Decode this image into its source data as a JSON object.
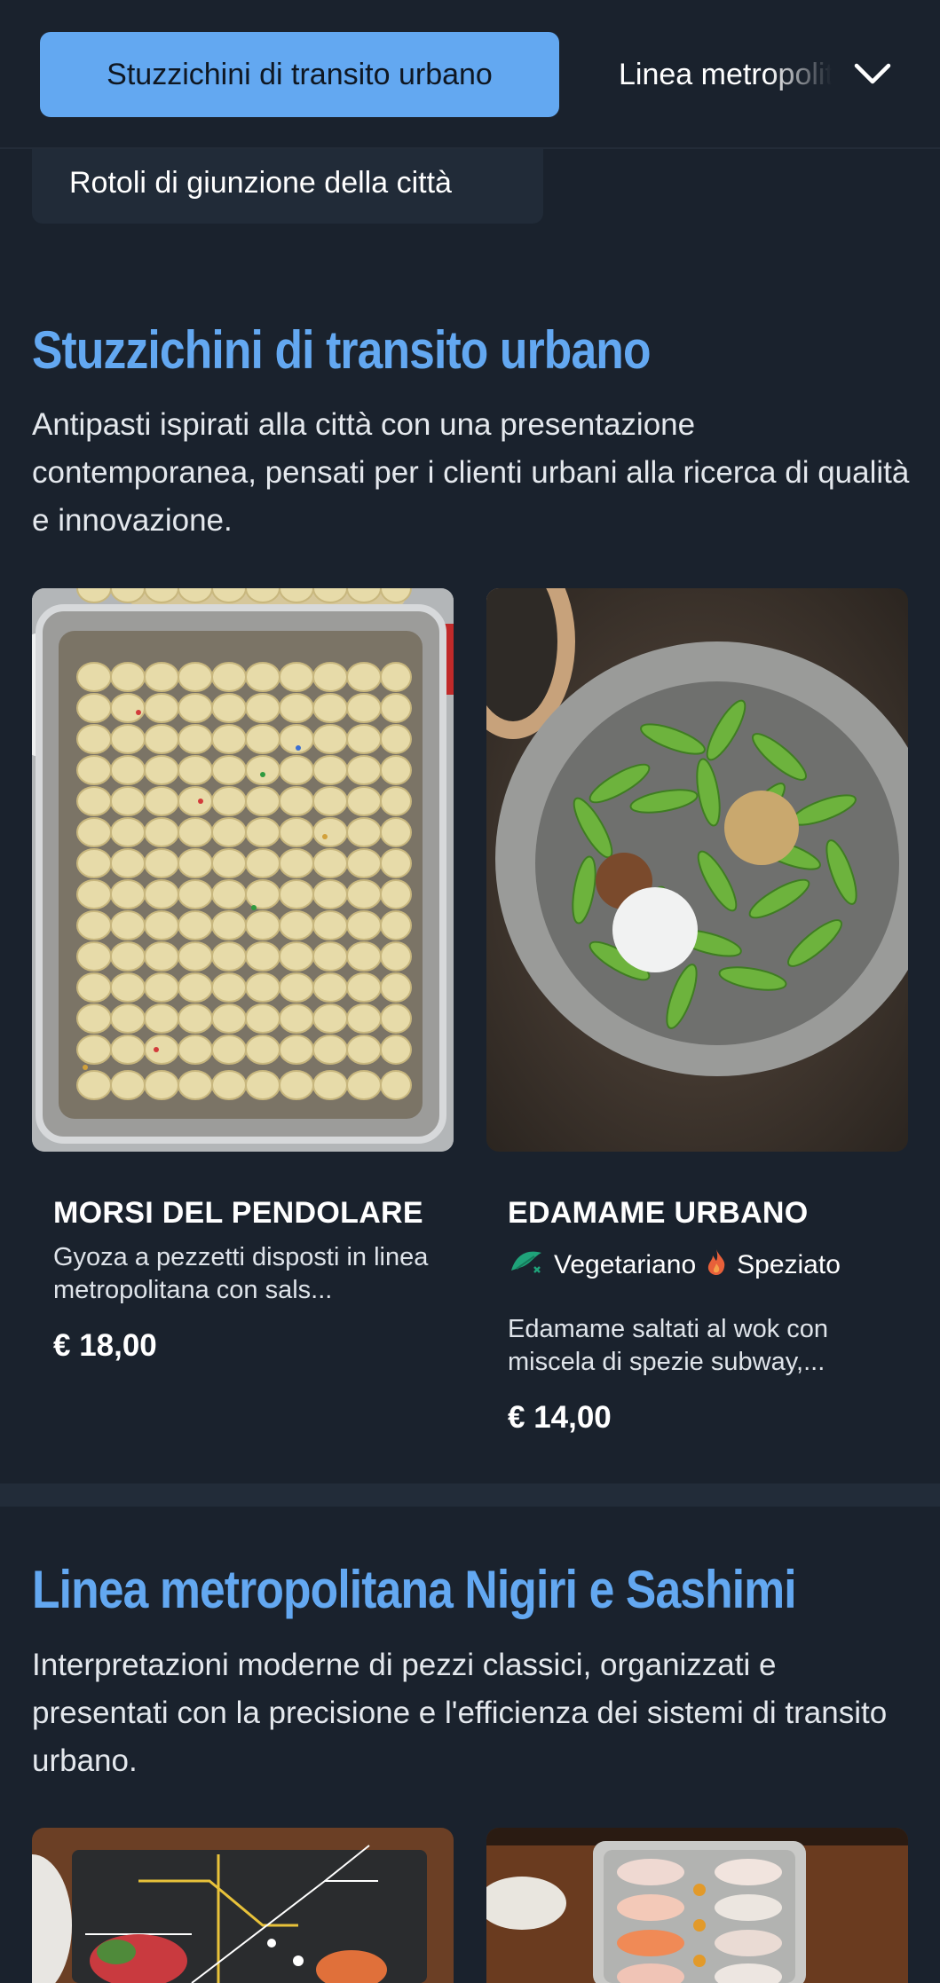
{
  "nav": {
    "active_tab": "Stuzzichini di transito urbano",
    "next_tab": "Linea metropolitana Nigiri e Sashimi",
    "dropdown_item": "Rotoli di giunzione della città"
  },
  "sections": [
    {
      "title": "Stuzzichini di transito urbano",
      "description": "Antipasti ispirati alla città con una presentazione contemporanea, pensati per i clienti urbani alla ricerca di qualità e innovazione.",
      "items": [
        {
          "name": "MORSI DEL PENDOLARE",
          "description": "Gyoza a pezzetti disposti in linea metropolitana con sals...",
          "price": "€ 18,00",
          "image_icon": "dumpling-tray-photo"
        },
        {
          "name": "EDAMAME URBANO",
          "tags": [
            {
              "label": "Vegetariano",
              "icon": "leaf-icon",
              "color": "#1fa37a"
            },
            {
              "label": "Speziato",
              "icon": "flame-icon",
              "color": "#e8603a"
            }
          ],
          "description": "Edamame saltati al wok con miscela di spezie subway,...",
          "price": "€ 14,00",
          "image_icon": "edamame-bowl-photo"
        }
      ]
    },
    {
      "title": "Linea metropolitana Nigiri e Sashimi",
      "description": "Interpretazioni moderne di pezzi classici, organizzati e presentati con la precisione e l'efficienza dei sistemi di transito urbano.",
      "items": [
        {
          "image_icon": "sashimi-metro-map-photo"
        },
        {
          "image_icon": "nigiri-plate-photo"
        }
      ]
    }
  ],
  "colors": {
    "background": "#1a222d",
    "accent": "#63a8f1",
    "panel": "#212b38"
  }
}
